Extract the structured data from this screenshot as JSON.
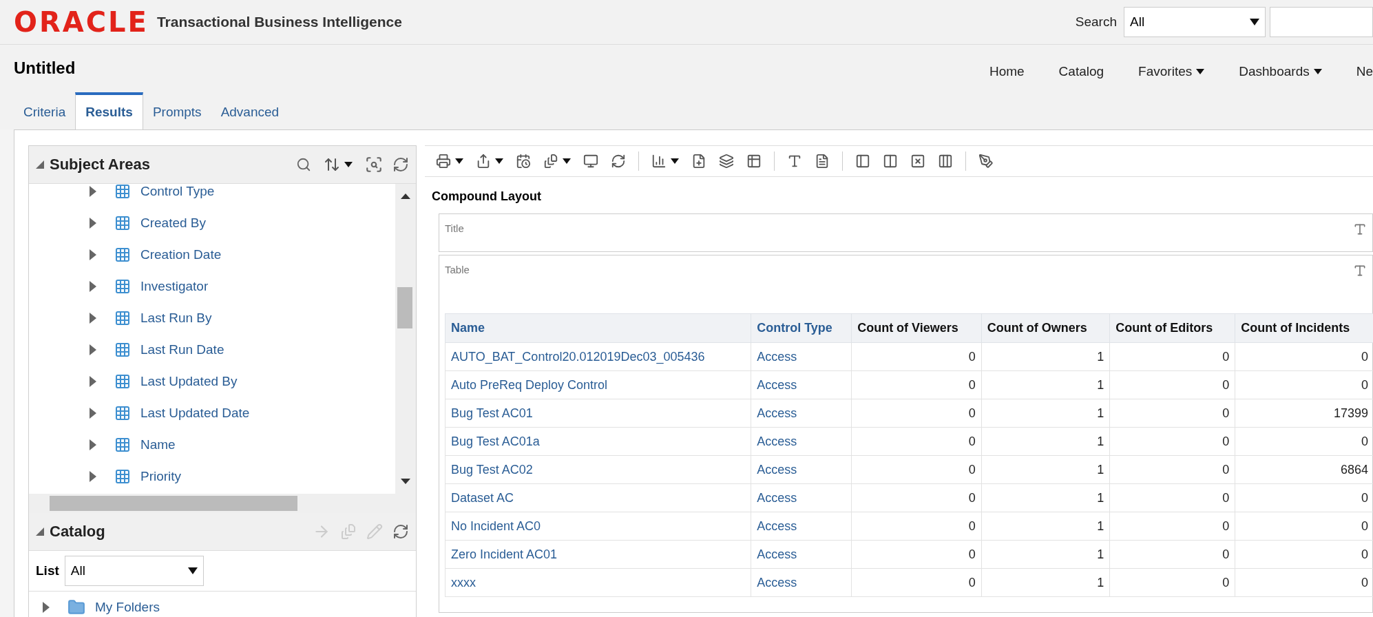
{
  "header": {
    "logo": "ORACLE",
    "product": "Transactional Business Intelligence",
    "search": {
      "label": "Search",
      "scope": "All"
    }
  },
  "page": {
    "title": "Untitled",
    "nav": [
      {
        "label": "Home",
        "menu": false
      },
      {
        "label": "Catalog",
        "menu": false
      },
      {
        "label": "Favorites",
        "menu": true
      },
      {
        "label": "Dashboards",
        "menu": true
      },
      {
        "label": "Ne",
        "menu": false
      }
    ]
  },
  "tabs": [
    {
      "label": "Criteria",
      "selected": false
    },
    {
      "label": "Results",
      "selected": true
    },
    {
      "label": "Prompts",
      "selected": false
    },
    {
      "label": "Advanced",
      "selected": false
    }
  ],
  "subject_areas": {
    "title": "Subject Areas",
    "items": [
      "Control Type",
      "Created By",
      "Creation Date",
      "Investigator",
      "Last Run By",
      "Last Run Date",
      "Last Updated By",
      "Last Updated Date",
      "Name",
      "Priority"
    ]
  },
  "catalog": {
    "title": "Catalog",
    "list_label": "List",
    "list_value": "All",
    "items": [
      "My Folders"
    ]
  },
  "layout": {
    "title": "Compound Layout",
    "views": [
      "Title",
      "Table"
    ]
  },
  "table": {
    "columns": [
      {
        "label": "Name",
        "kind": "attribute"
      },
      {
        "label": "Control Type",
        "kind": "attribute"
      },
      {
        "label": "Count of Viewers",
        "kind": "measure"
      },
      {
        "label": "Count of Owners",
        "kind": "measure"
      },
      {
        "label": "Count of Editors",
        "kind": "measure"
      },
      {
        "label": "Count of Incidents",
        "kind": "measure"
      }
    ],
    "rows": [
      [
        "AUTO_BAT_Control20.012019Dec03_005436",
        "Access",
        "0",
        "1",
        "0",
        "0"
      ],
      [
        "Auto PreReq Deploy Control",
        "Access",
        "0",
        "1",
        "0",
        "0"
      ],
      [
        "Bug Test AC01",
        "Access",
        "0",
        "1",
        "0",
        "17399"
      ],
      [
        "Bug Test AC01a",
        "Access",
        "0",
        "1",
        "0",
        "0"
      ],
      [
        "Bug Test AC02",
        "Access",
        "0",
        "1",
        "0",
        "6864"
      ],
      [
        "Dataset AC",
        "Access",
        "0",
        "1",
        "0",
        "0"
      ],
      [
        "No Incident AC0",
        "Access",
        "0",
        "1",
        "0",
        "0"
      ],
      [
        "Zero Incident AC01",
        "Access",
        "0",
        "1",
        "0",
        "0"
      ],
      [
        "xxxx",
        "Access",
        "0",
        "1",
        "0",
        "0"
      ]
    ]
  }
}
